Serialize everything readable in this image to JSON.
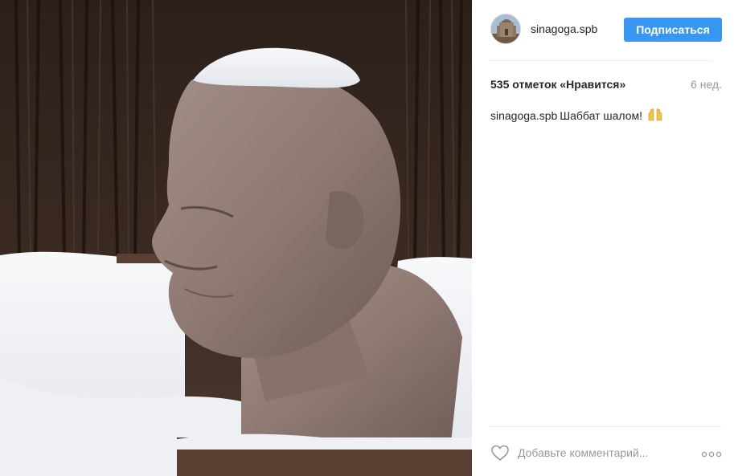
{
  "post": {
    "photo_icon": "snowy-bust-photo",
    "author": {
      "username": "sinagoga.spb",
      "avatar_icon": "synagogue-avatar"
    },
    "follow_label": "Подписаться",
    "likes_label": "535 отметок «Нравится»",
    "date_label": "6 нед.",
    "caption": {
      "author": "sinagoga.spb",
      "text": "Шаббат шалом!",
      "emoji_icon": "raising-hands-emoji"
    },
    "comment": {
      "placeholder": "Добавьте комментарий...",
      "like_icon": "heart-icon",
      "more_icon": "more-dots-icon"
    }
  },
  "colors": {
    "accent": "#3897f0",
    "text": "#262626",
    "muted": "#999999",
    "divider": "#efefef"
  }
}
